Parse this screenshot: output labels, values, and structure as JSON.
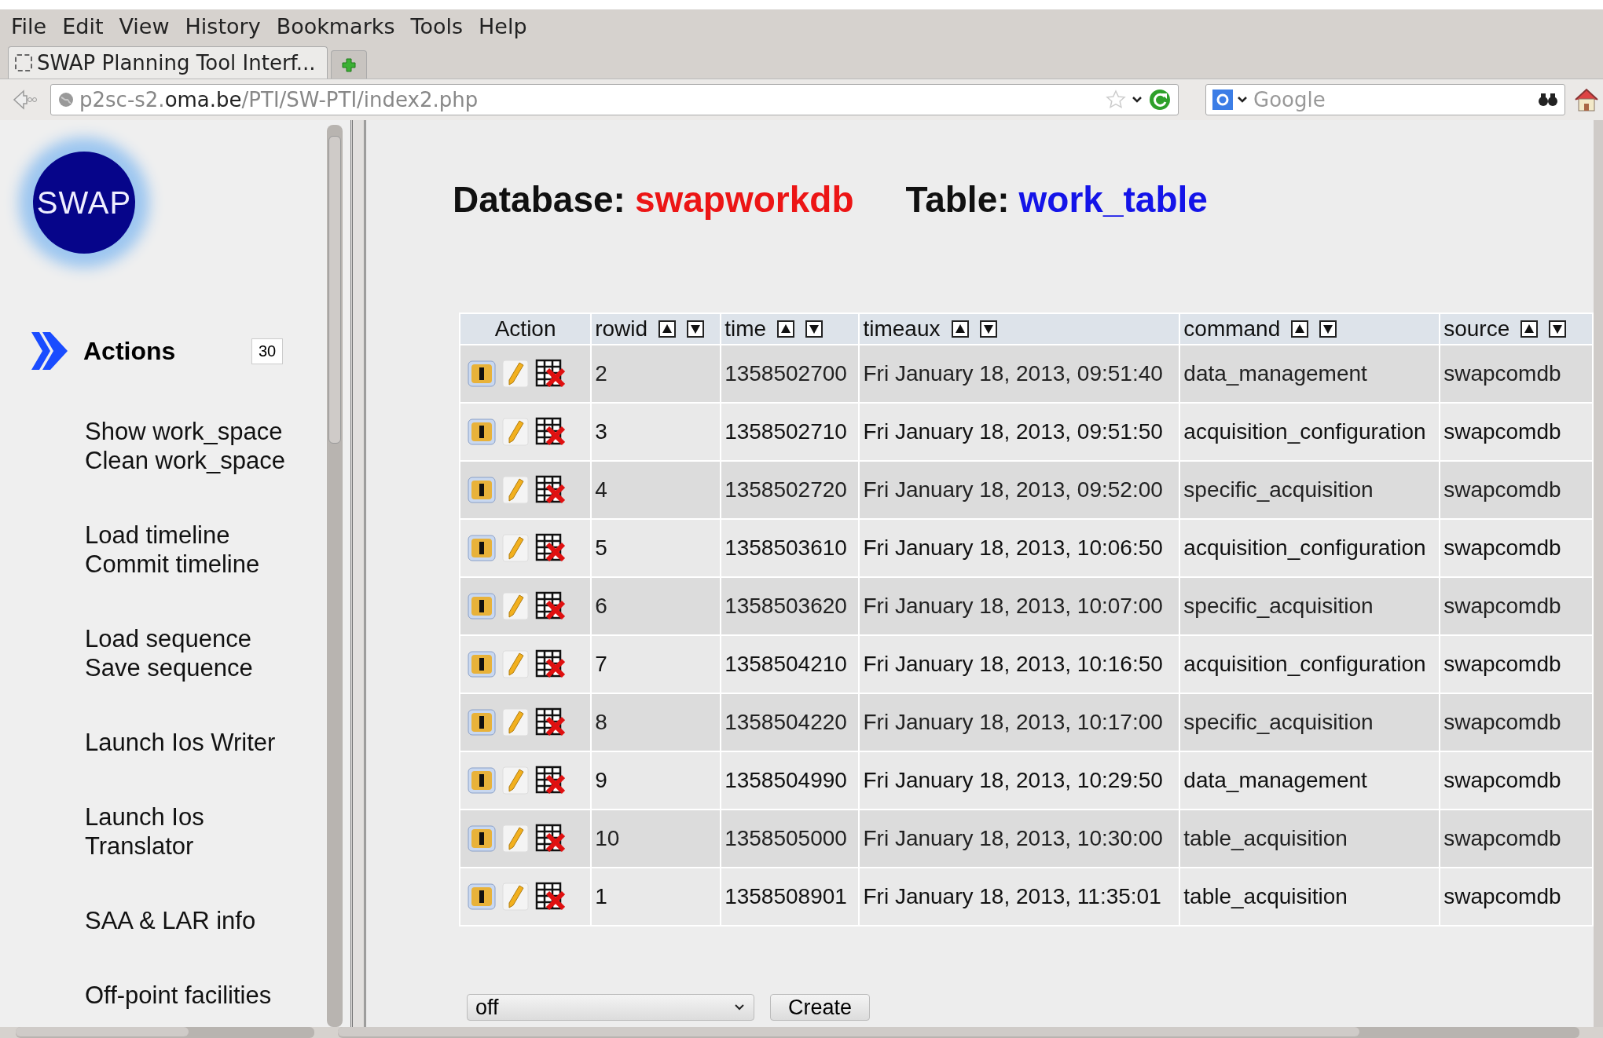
{
  "menu": [
    "File",
    "Edit",
    "View",
    "History",
    "Bookmarks",
    "Tools",
    "Help"
  ],
  "tabs": [
    {
      "label": "SWAP Planning Tool Interf...",
      "selected": true
    }
  ],
  "address": {
    "prefix": "p2sc-s2.",
    "domain": "oma.be",
    "path": "/PTI/SW-PTI/index2.php"
  },
  "search": {
    "placeholder": "Google"
  },
  "sidebar": {
    "logo": "SWAP",
    "section": {
      "title": "Actions",
      "count": "30"
    },
    "groups": [
      [
        "Show work_space",
        "Clean work_space"
      ],
      [
        "Load timeline",
        "Commit timeline"
      ],
      [
        "Load sequence",
        "Save sequence"
      ],
      [
        "Launch Ios Writer"
      ],
      [
        "Launch Ios Translator"
      ],
      [
        "SAA & LAR info"
      ],
      [
        "Off-point facilities"
      ]
    ]
  },
  "header": {
    "database_label": "Database:",
    "database": "swapworkdb",
    "table_label": "Table:",
    "table": "work_table"
  },
  "table": {
    "columns": [
      {
        "label": "Action",
        "sortable": false
      },
      {
        "label": "rowid",
        "sortable": true
      },
      {
        "label": "time",
        "sortable": true
      },
      {
        "label": "timeaux",
        "sortable": true
      },
      {
        "label": "command",
        "sortable": true
      },
      {
        "label": "source",
        "sortable": true
      }
    ],
    "rows": [
      {
        "rowid": "2",
        "time": "1358502700",
        "timeaux": "Fri January 18, 2013, 09:51:40",
        "command": "data_management",
        "source": "swapcomdb"
      },
      {
        "rowid": "3",
        "time": "1358502710",
        "timeaux": "Fri January 18, 2013, 09:51:50",
        "command": "acquisition_configuration",
        "source": "swapcomdb"
      },
      {
        "rowid": "4",
        "time": "1358502720",
        "timeaux": "Fri January 18, 2013, 09:52:00",
        "command": "specific_acquisition",
        "source": "swapcomdb"
      },
      {
        "rowid": "5",
        "time": "1358503610",
        "timeaux": "Fri January 18, 2013, 10:06:50",
        "command": "acquisition_configuration",
        "source": "swapcomdb"
      },
      {
        "rowid": "6",
        "time": "1358503620",
        "timeaux": "Fri January 18, 2013, 10:07:00",
        "command": "specific_acquisition",
        "source": "swapcomdb"
      },
      {
        "rowid": "7",
        "time": "1358504210",
        "timeaux": "Fri January 18, 2013, 10:16:50",
        "command": "acquisition_configuration",
        "source": "swapcomdb"
      },
      {
        "rowid": "8",
        "time": "1358504220",
        "timeaux": "Fri January 18, 2013, 10:17:00",
        "command": "specific_acquisition",
        "source": "swapcomdb"
      },
      {
        "rowid": "9",
        "time": "1358504990",
        "timeaux": "Fri January 18, 2013, 10:29:50",
        "command": "data_management",
        "source": "swapcomdb"
      },
      {
        "rowid": "10",
        "time": "1358505000",
        "timeaux": "Fri January 18, 2013, 10:30:00",
        "command": "table_acquisition",
        "source": "swapcomdb"
      },
      {
        "rowid": "1",
        "time": "1358508901",
        "timeaux": "Fri January 18, 2013, 11:35:01",
        "command": "table_acquisition",
        "source": "swapcomdb"
      }
    ]
  },
  "footer": {
    "select": "off",
    "button": "Create"
  }
}
